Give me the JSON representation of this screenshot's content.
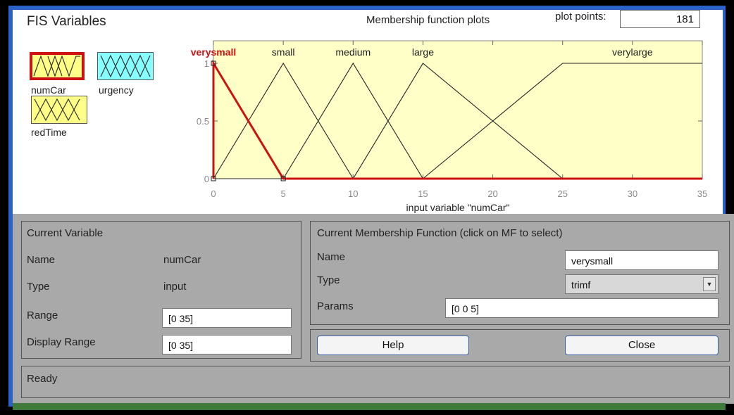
{
  "fis_variables": {
    "title": "FIS Variables",
    "items": [
      {
        "label": "numCar",
        "selected": true,
        "color": "#ffff88"
      },
      {
        "label": "urgency",
        "selected": false,
        "color": "#88ffff"
      },
      {
        "label": "redTime",
        "selected": false,
        "color": "#ffff88"
      }
    ]
  },
  "plot": {
    "title": "Membership function plots",
    "plot_points_label": "plot points:",
    "plot_points_value": "181",
    "xlabel": "input variable \"numCar\"",
    "x_ticks": [
      "0",
      "5",
      "10",
      "15",
      "20",
      "25",
      "30",
      "35"
    ],
    "y_ticks": [
      "0",
      "0.5",
      "1"
    ],
    "xlim": [
      0,
      35
    ],
    "ylim": [
      0,
      1
    ],
    "background": "#ffffc8",
    "selected_color": "#cc1111"
  },
  "chart_data": {
    "type": "line",
    "xlabel": "input variable \"numCar\"",
    "ylabel": "",
    "xlim": [
      0,
      35
    ],
    "ylim": [
      0,
      1
    ],
    "series": [
      {
        "name": "verysmall",
        "x": [
          0,
          0,
          5,
          35
        ],
        "y": [
          0,
          1,
          0,
          0
        ],
        "selected": true
      },
      {
        "name": "small",
        "x": [
          0,
          5,
          10,
          35
        ],
        "y": [
          0,
          1,
          0,
          0
        ]
      },
      {
        "name": "medium",
        "x": [
          0,
          5,
          10,
          15,
          35
        ],
        "y": [
          0,
          0,
          1,
          0,
          0
        ]
      },
      {
        "name": "large",
        "x": [
          0,
          10,
          15,
          25,
          35
        ],
        "y": [
          0,
          0,
          1,
          0,
          0
        ]
      },
      {
        "name": "verylarge",
        "x": [
          0,
          15,
          25,
          35
        ],
        "y": [
          0,
          0,
          1,
          1
        ]
      }
    ]
  },
  "current_variable": {
    "title": "Current Variable",
    "name_label": "Name",
    "name_value": "numCar",
    "type_label": "Type",
    "type_value": "input",
    "range_label": "Range",
    "range_value": "[0 35]",
    "display_range_label": "Display Range",
    "display_range_value": "[0 35]"
  },
  "current_mf": {
    "title": "Current Membership Function (click on MF to select)",
    "name_label": "Name",
    "name_value": "verysmall",
    "type_label": "Type",
    "type_value": "trimf",
    "params_label": "Params",
    "params_value": "[0 0 5]"
  },
  "buttons": {
    "help": "Help",
    "close": "Close"
  },
  "status": "Ready"
}
